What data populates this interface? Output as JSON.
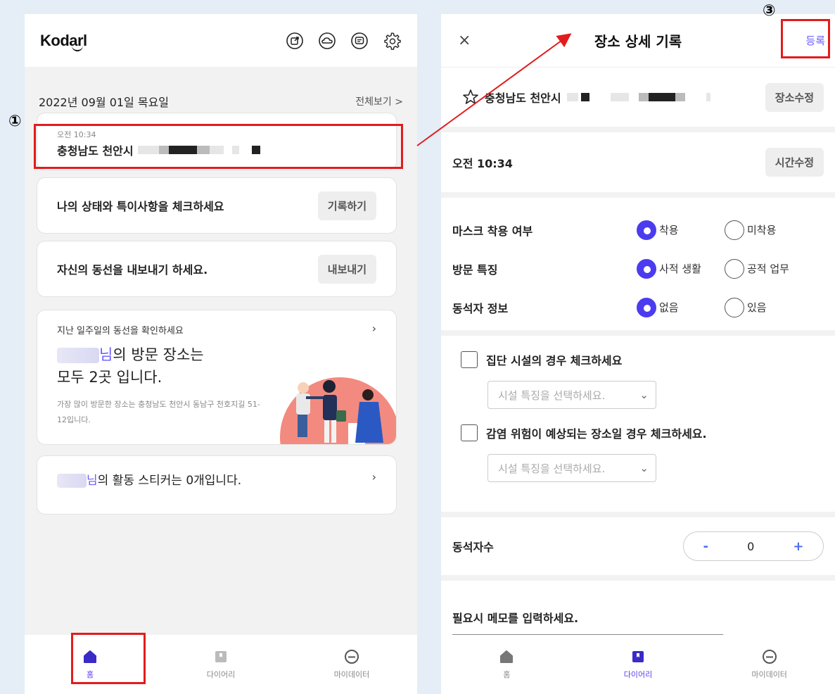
{
  "left": {
    "logo": "Kodarl",
    "date": "2022년 09월 01일 목요일",
    "see_all": "전체보기 >",
    "location": {
      "time": "오전 10:34",
      "name": "충청남도 천안시"
    },
    "status_card": {
      "text": "나의 상태와 특이사항을 체크하세요",
      "button": "기록하기"
    },
    "export_card": {
      "text": "자신의 동선을 내보내기 하세요.",
      "button": "내보내기"
    },
    "week_card": {
      "subtitle": "지난 일주일의 동선을 확인하세요",
      "name_suffix": "님",
      "line1_rest": "의 방문 장소는",
      "line2": "모두 2곳 입니다.",
      "footer": "가장 많이 방문한 장소는 충청남도 천안시 동남구 천호지길 51-12입니다."
    },
    "sticker_card": {
      "name_suffix": "님",
      "text_rest": "의 활동 스티커는 0개입니다."
    },
    "nav": [
      {
        "label": "홈",
        "icon": "home-icon"
      },
      {
        "label": "다이어리",
        "icon": "bookmark-icon"
      },
      {
        "label": "마이데이터",
        "icon": "chat-bubble-icon"
      }
    ],
    "marker": "①",
    "icons": [
      "share-icon",
      "cloud-icon",
      "message-icon",
      "gear-icon"
    ]
  },
  "right": {
    "close": "×",
    "title": "장소 상세 기록",
    "register": "등록",
    "marker": "③",
    "place": {
      "name": "충청남도 천안시",
      "button": "장소수정"
    },
    "time": {
      "text": "오전 10:34",
      "button": "시간수정"
    },
    "questions": [
      {
        "label": "마스크 착용 여부",
        "opt1": "착용",
        "opt2": "미착용"
      },
      {
        "label": "방문 특징",
        "opt1": "사적 생활",
        "opt2": "공적 업무"
      },
      {
        "label": "동석자 정보",
        "opt1": "없음",
        "opt2": "있음"
      }
    ],
    "check1": "집단 시설의 경우 체크하세요",
    "check2": "감염 위험이 예상되는 장소일 경우 체크하세요.",
    "select_placeholder": "시설 특징을 선택하세요.",
    "count_label": "동석자수",
    "count": {
      "minus": "-",
      "value": "0",
      "plus": "+"
    },
    "memo_label": "필요시 메모를 입력하세요.",
    "nav": [
      {
        "label": "홈",
        "icon": "home-icon"
      },
      {
        "label": "다이어리",
        "icon": "bookmark-icon"
      },
      {
        "label": "마이데이터",
        "icon": "chat-bubble-icon"
      }
    ]
  },
  "colors": {
    "accent": "#5b3cf0",
    "highlight": "#e21c1c",
    "background": "#e5edf6"
  }
}
